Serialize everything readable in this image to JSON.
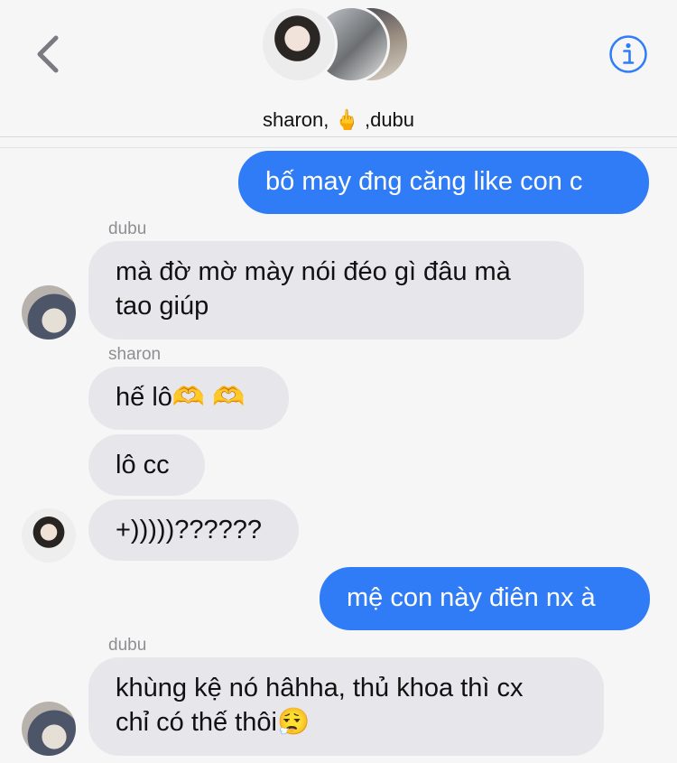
{
  "header": {
    "group_title": "sharon, 🖕 ,dubu",
    "back_icon": "chevron-left-icon",
    "info_icon": "info-icon",
    "accent": "#2f7cf6"
  },
  "messages": [
    {
      "type": "out",
      "text": "bố may đng căng like con c"
    },
    {
      "type": "in",
      "sender": "dubu",
      "lines": [
        "mà đờ mờ mày nói đéo gì đâu mà",
        "tao giúp"
      ]
    },
    {
      "type": "in",
      "sender": "sharon",
      "text": "hế lô🫶 🫶"
    },
    {
      "type": "in",
      "text": "lô cc"
    },
    {
      "type": "in",
      "text": "+)))))??????"
    },
    {
      "type": "out",
      "text": "mệ con này điên nx à"
    },
    {
      "type": "in",
      "sender": "dubu",
      "lines": [
        "khùng kệ nó hâhha, thủ khoa thì cx",
        "chỉ có thế thôi😮‍💨"
      ]
    }
  ]
}
